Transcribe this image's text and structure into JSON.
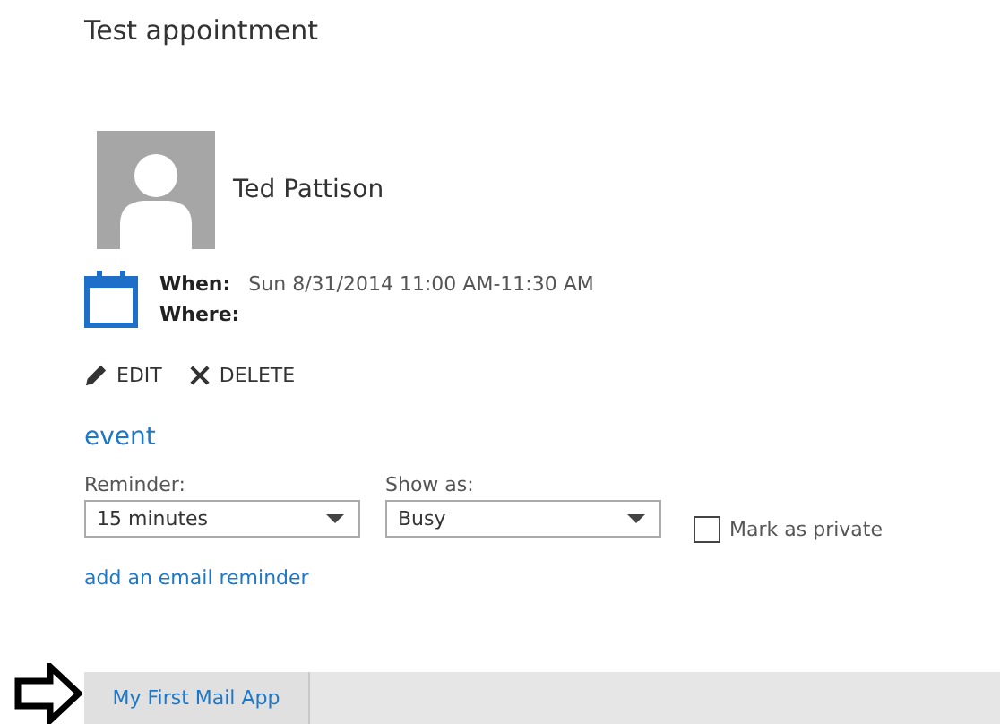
{
  "title": "Test appointment",
  "organizer": {
    "name": "Ted Pattison"
  },
  "details": [
    {
      "label": "When:",
      "value": "Sun 8/31/2014 11:00 AM-11:30 AM"
    },
    {
      "label": "Where:"
    }
  ],
  "actions": [
    {
      "kind": "edit",
      "label": "EDIT"
    },
    {
      "kind": "delete",
      "label": "DELETE"
    }
  ],
  "category": "event",
  "reminder": {
    "label": "Reminder:",
    "value": "15 minutes"
  },
  "show_as": {
    "label": "Show as:",
    "value": "Busy"
  },
  "private": {
    "label": "Mark as private",
    "checked": false
  },
  "email_reminder_link": "add an email reminder",
  "app_tabs": [
    {
      "label": "My First Mail App",
      "selected": true
    }
  ]
}
